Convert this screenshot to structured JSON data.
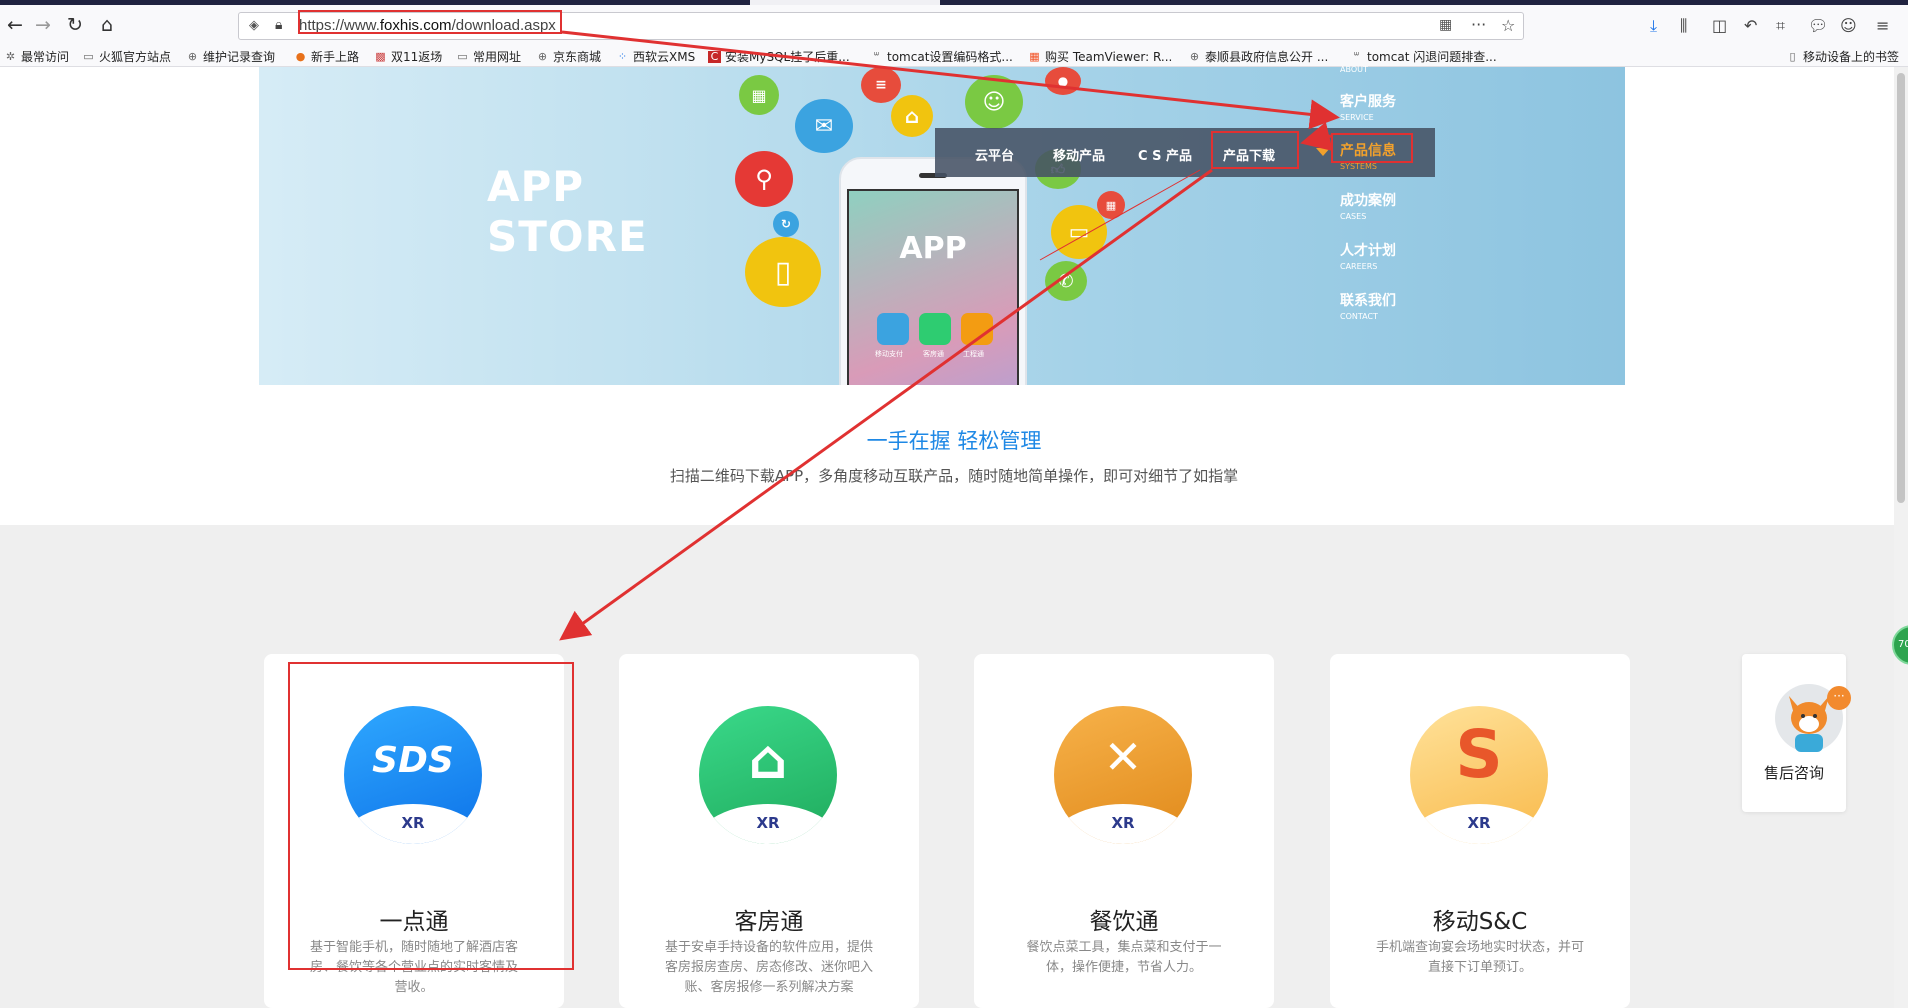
{
  "browser": {
    "url_prefix": "https://www.",
    "url_host": "foxhis.com",
    "url_path": "/download.aspx",
    "bookmarks": [
      "最常访问",
      "火狐官方站点",
      "维护记录查询",
      "新手上路",
      "双11返场",
      "常用网址",
      "京东商城",
      "西软云XMS",
      "安装MySQL挂了后重...",
      "tomcat设置编码格式...",
      "购买 TeamViewer: R...",
      "泰顺县政府信息公开 ...",
      "tomcat 闪退问题排查..."
    ],
    "mobile_bookmarks": "移动设备上的书签"
  },
  "banner": {
    "app_store_line1": "APP",
    "app_store_line2": "STORE",
    "phone_title": "APP",
    "phone_apps": [
      "移动支付",
      "客房通",
      "工程通"
    ]
  },
  "menu": {
    "items": [
      "云平台",
      "移动产品",
      "C S 产品",
      "产品下载"
    ],
    "side_items": [
      {
        "cn": "客户服务",
        "en": "SERVICE"
      },
      {
        "cn": "产品信息",
        "en": "SYSTEMS"
      },
      {
        "cn": "成功案例",
        "en": "CASES"
      },
      {
        "cn": "人才计划",
        "en": "CAREERS"
      },
      {
        "cn": "联系我们",
        "en": "CONTACT"
      }
    ],
    "side_top_partial": "ABOUT"
  },
  "intro": {
    "slogan": "一手在握 轻松管理",
    "subtitle": "扫描二维码下载APP，多角度移动互联产品，随时随地简单操作，即可对细节了如指掌"
  },
  "products": [
    {
      "title": "一点通",
      "desc": "基于智能手机，随时随地了解酒店客房、餐饮等各个营业点的实时客情及营收。",
      "mark": "SDS",
      "color": "#1e90ff"
    },
    {
      "title": "客房通",
      "desc": "基于安卓手持设备的软件应用，提供客房报房查房、房态修改、迷你吧入账、客房报修一系列解决方案",
      "mark": "⌂",
      "color": "#2ecc71"
    },
    {
      "title": "餐饮通",
      "desc": "餐饮点菜工具，集点菜和支付于一体，操作便捷，节省人力。",
      "mark": "✕",
      "color": "#f0a020"
    },
    {
      "title": "移动S&C",
      "desc": "手机端查询宴会场地实时状态，并可直接下订单预订。",
      "mark": "S",
      "color": "#f7b733"
    }
  ],
  "product_badge": "XR",
  "service": {
    "label": "售后咨询",
    "dots": "···"
  },
  "side_badge": "70"
}
